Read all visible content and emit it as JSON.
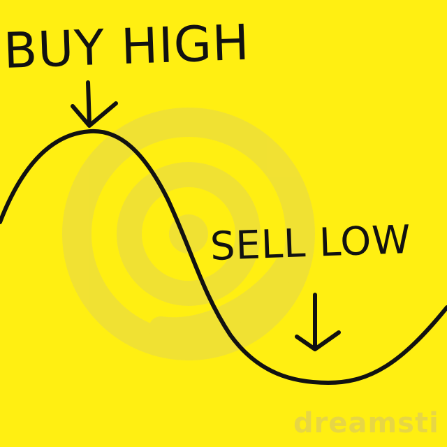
{
  "image": {
    "background_color": "#ffef12",
    "ink_color": "#111111",
    "watermark_color": "#e5d44b"
  },
  "labels": {
    "buy": "BUY HIGH",
    "sell": "SELL LOW"
  },
  "watermark": {
    "text": "dreamsti"
  }
}
